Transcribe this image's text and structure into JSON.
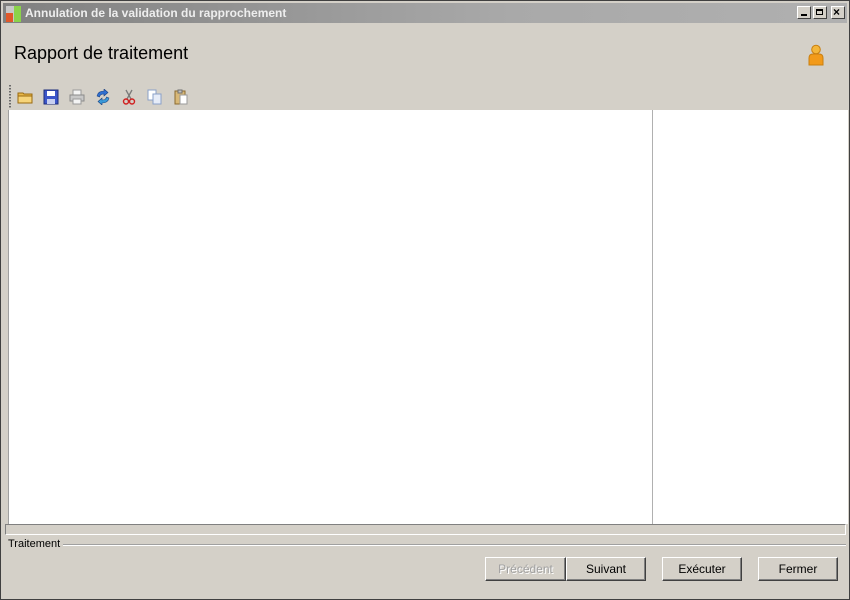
{
  "window": {
    "title": "Annulation de la validation du rapprochement",
    "controls": {
      "minimize_icon": "minimize-icon",
      "maximize_icon": "maximize-icon",
      "close_icon": "close-icon",
      "close_glyph": "×"
    }
  },
  "header": {
    "title": "Rapport de traitement",
    "user_icon": "user-icon"
  },
  "toolbar": {
    "items": [
      {
        "name": "open-icon",
        "enabled": true
      },
      {
        "name": "save-icon",
        "enabled": true
      },
      {
        "name": "print-icon",
        "enabled": false
      },
      {
        "name": "refresh-icon",
        "enabled": true
      },
      {
        "name": "cut-icon",
        "enabled": true
      },
      {
        "name": "copy-icon",
        "enabled": false
      },
      {
        "name": "paste-icon",
        "enabled": false
      }
    ]
  },
  "group": {
    "label": "Traitement"
  },
  "buttons": {
    "previous": {
      "label": "Précédent",
      "enabled": false
    },
    "next": {
      "label": "Suivant",
      "enabled": true
    },
    "execute": {
      "label": "Exécuter",
      "enabled": true
    },
    "close": {
      "label": "Fermer",
      "enabled": true
    }
  },
  "colors": {
    "window_bg": "#d4d0c8",
    "content_bg": "#ffffff",
    "title_bar": "#808080",
    "disabled_text": "#a0a0a0"
  }
}
